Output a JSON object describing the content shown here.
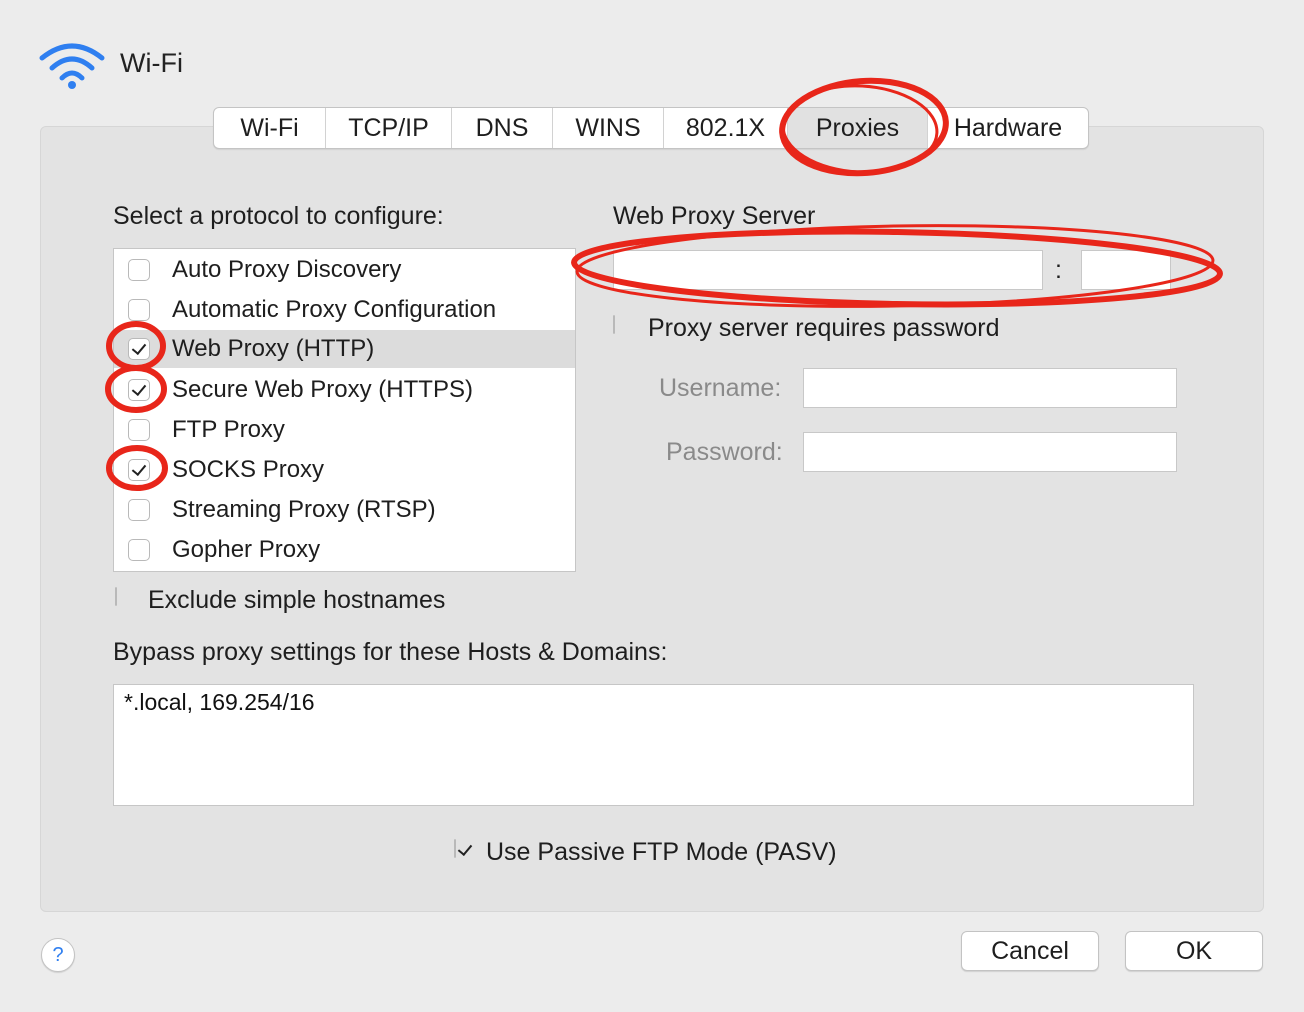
{
  "window": {
    "title": "Wi-Fi"
  },
  "tabs": [
    {
      "label": "Wi-Fi",
      "active": false
    },
    {
      "label": "TCP/IP",
      "active": false
    },
    {
      "label": "DNS",
      "active": false
    },
    {
      "label": "WINS",
      "active": false
    },
    {
      "label": "802.1X",
      "active": false
    },
    {
      "label": "Proxies",
      "active": true
    },
    {
      "label": "Hardware",
      "active": false
    }
  ],
  "protocols": {
    "heading": "Select a protocol to configure:",
    "items": [
      {
        "label": "Auto Proxy Discovery",
        "checked": false,
        "selected": false
      },
      {
        "label": "Automatic Proxy Configuration",
        "checked": false,
        "selected": false
      },
      {
        "label": "Web Proxy (HTTP)",
        "checked": true,
        "selected": true
      },
      {
        "label": "Secure Web Proxy (HTTPS)",
        "checked": true,
        "selected": false
      },
      {
        "label": "FTP Proxy",
        "checked": false,
        "selected": false
      },
      {
        "label": "SOCKS Proxy",
        "checked": true,
        "selected": false
      },
      {
        "label": "Streaming Proxy (RTSP)",
        "checked": false,
        "selected": false
      },
      {
        "label": "Gopher Proxy",
        "checked": false,
        "selected": false
      }
    ]
  },
  "proxy_server": {
    "heading": "Web Proxy Server",
    "host_value": "",
    "separator": ":",
    "port_value": "",
    "requires_password_label": "Proxy server requires password",
    "requires_password_checked": false,
    "username_label": "Username:",
    "username_value": "",
    "password_label": "Password:",
    "password_value": ""
  },
  "exclude_simple": {
    "label": "Exclude simple hostnames",
    "checked": false
  },
  "bypass": {
    "label": "Bypass proxy settings for these Hosts & Domains:",
    "value": "*.local, 169.254/16"
  },
  "passive_ftp": {
    "label": "Use Passive FTP Mode (PASV)",
    "checked": true
  },
  "buttons": {
    "help": "?",
    "cancel": "Cancel",
    "ok": "OK"
  },
  "colors": {
    "accent": "#2f7ff0",
    "annotation": "#e8261a"
  }
}
